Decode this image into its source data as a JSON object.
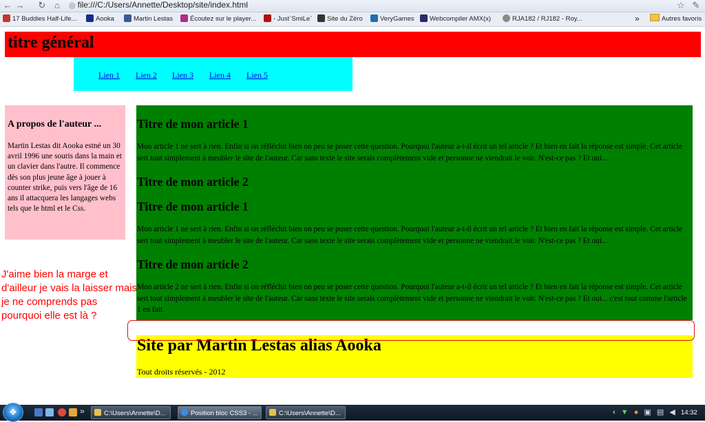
{
  "browser": {
    "address": "file:///C:/Users/Annette/Desktop/site/index.html",
    "bookmarks": [
      {
        "label": "17 Buddies Half-Life...",
        "color": "#c0392b"
      },
      {
        "label": "Aooka",
        "color": "#1a2a8c"
      },
      {
        "label": "Martin Lestas",
        "color": "#3b5998"
      },
      {
        "label": "Écoutez sur le player...",
        "color": "#b02b8a"
      },
      {
        "label": "- Just`SmiLe`",
        "color": "#b01010"
      },
      {
        "label": "Site du Zéro",
        "color": "#333333"
      },
      {
        "label": "VeryGames",
        "color": "#1f6fb2"
      },
      {
        "label": "Webcompiler AMX(x)",
        "color": "#2a2a6a"
      },
      {
        "label": "RJA182 / RJ182 - Roy...",
        "color": "#8a8a8a"
      }
    ],
    "more_label": "»",
    "other_bookmarks": "Autres favoris"
  },
  "page": {
    "header_title": "titre général",
    "nav_links": [
      "Lien 1",
      "Lien 2",
      "Lien 3",
      "Lien 4",
      "Lien 5"
    ],
    "aside": {
      "title": "A propos de l'auteur ...",
      "text": "Martin Lestas dit Aooka estné un 30 avril 1996 une souris dans la main et un clavier dans l'autre. Il commence dès son plus jeune âge à jouer à counter strike, puis vers l'âge de 16 ans il attacquera les langages webs tels que le html et le Css."
    },
    "annotation": "J'aime bien la marge et d'ailleur je vais la laisser mais je ne comprends pas pourquoi elle est là ?",
    "articles": {
      "title_1a": "Titre de mon article 1",
      "text_1a": "Mon article 1 ne sert à rien. Enfin si on réfléchit bien on peu se poser cette question. Pourquoi l'auteur a-t-il écrit un tel article ? Et bien en fait la réponse est simple. Cet article sert tout simplement à meubler le site de l'auteur. Car sans texte le site serais complètement vide et personne ne viendrait le voir. N'est-ce pas ? Et oui...",
      "title_2a": "Titre de mon article 2",
      "title_1b": "Titre de mon article 1",
      "text_1b": "Mon article 1 ne sert à rien. Enfin si on réfléchit bien on peu se poser cette question. Pourquoi l'auteur a-t-il écrit un tel article ? Et bien en fait la réponse est simple. Cet article sert tout simplement à meubler le site de l'auteur. Car sans texte le site serais complètement vide et personne ne viendrait le voir. N'est-ce pas ? Et oui...",
      "title_2b": "Titre de mon article 2",
      "text_2b": "Mon article 2 ne sert à rien. Enfin si on réfléchit bien on peu se poser cette question. Pourquoi l'auteur a-t-il écrit un tel article ? Et bien en fait la réponse est simple. Cet article sert tout simplement à meubler le site de l'auteur. Car sans texte le site serais complètement vide et personne ne viendrait le voir. N'est-ce pas ? Et oui... c'est tout comme l'article 1 en fait."
    },
    "footer": {
      "title": "Site par Martin Lestas alias Aooka",
      "text": "Tout droits réservés - 2012"
    },
    "colors": {
      "header": "#ff0000",
      "nav": "#00ffff",
      "aside": "#ffc0cb",
      "main": "#008000",
      "footer": "#ffff00",
      "annotation": "#ff0000"
    }
  },
  "taskbar": {
    "more_label": "»",
    "tasks": [
      {
        "label": "C:\\Users\\Annette\\D...",
        "color": "#e8c04a"
      },
      {
        "label": "Position bloc CSS3 - ...",
        "color": "#3a8de0"
      },
      {
        "label": "C:\\Users\\Annette\\D...",
        "color": "#e8c04a"
      }
    ],
    "tray_more": "‹",
    "clock": "14:32"
  }
}
